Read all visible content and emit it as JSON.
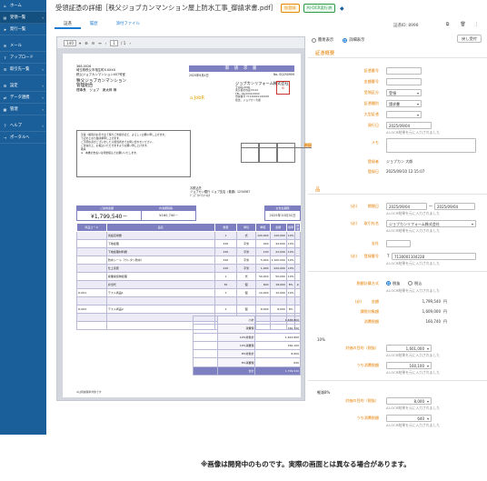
{
  "sidebar": {
    "items": [
      {
        "label": "ホーム",
        "icon": "home-icon",
        "active": false
      },
      {
        "label": "受領一覧",
        "icon": "inbox-icon",
        "active": true
      },
      {
        "label": "発行一覧",
        "icon": "send-icon",
        "active": false
      },
      {
        "label": "メール",
        "icon": "mail-icon",
        "active": false
      },
      {
        "label": "アップロード",
        "icon": "upload-icon",
        "active": false
      },
      {
        "label": "取引先一覧",
        "icon": "address-book-icon",
        "active": false
      },
      {
        "label": "設定",
        "icon": "gear-icon",
        "active": false
      },
      {
        "label": "データ連携",
        "icon": "link-icon",
        "active": false
      },
      {
        "label": "管理",
        "icon": "admin-icon",
        "active": false
      },
      {
        "label": "ヘルプ",
        "icon": "help-icon",
        "active": false
      },
      {
        "label": "ポータルへ",
        "icon": "arrow-right-icon",
        "active": false
      }
    ]
  },
  "header": {
    "title": "受領証憑の詳細［秩父ジョブカンマンション屋上防水工事_御請求書.pdf］",
    "badge_status": "仮登録",
    "badge_ai": "AI-OCR実行済",
    "doc_id": "証憑ID: 8998",
    "back_label": "戻し受付"
  },
  "tabs": [
    {
      "label": "証憑",
      "active": true
    },
    {
      "label": "履歴",
      "active": false
    },
    {
      "label": "添付ファイル",
      "active": false
    }
  ],
  "viewer": {
    "zoom": "140",
    "page_current": "1",
    "page_total": "/ 1"
  },
  "invoice": {
    "sender_lines": [
      "368-0026",
      "埼玉県秩父市相生町X-XXXX",
      "秩父ジョブカンマンション407号室"
    ],
    "recipient_name": "秩父ジョブカンマンション",
    "recipient_dept": "管理組合",
    "recipient_person": "理事長　ジョブ　席太郎 様",
    "title": "御 請 求 書",
    "date": "2025年9月4日",
    "number": "No. SQ250909",
    "company": "ジョブカンリフォーム株式会社",
    "address_lines": [
      "〒000-0000",
      "東京都渋谷区XX-XX",
      "TEL: 00-0000-0000",
      "登録番号 T7130001104228",
      "担当：ジョブカン大郎"
    ],
    "logo_text": "JobR",
    "seal_text": "印",
    "note_lines": [
      "平素（格別のお引き立て賜りご支援のほど、よろしくお願い申し上げます。",
      "下記のとおり御請求申し上げます。",
      "ご不明な点がございましたら担当者までお問い合わせください。",
      "ご査収の上、お振込いただきますようお願い申し上げます。",
      "",
      "敬具",
      "※　本書の支払いは現金振込でお願いいたします。"
    ],
    "stamp_labels": [
      "検印",
      "承認",
      "担当"
    ],
    "bank_lines": [
      "お振込先",
      "ジョブカン銀行 ジョブ支店（普通）1234567",
      "ｼﾞｮﾌﾞｶﾝﾘﾌｫｰﾑ(ｶ"
    ],
    "total_head": [
      "ご請求金額",
      "内消費税等"
    ],
    "total_amount": "¥1,799,540－",
    "tax_amount": "¥160,740－",
    "due_label": "お支払期限",
    "due_date": "2025年10月31日",
    "table_headers": [
      "商品コード",
      "品名",
      "数量",
      "単位",
      "単価",
      "金額",
      "税率",
      "摘要"
    ],
    "rows": [
      [
        "",
        "仮設足場費",
        "1",
        "式",
        "120,000",
        "120,000",
        "10%",
        ""
      ],
      [
        "",
        "下地処理",
        "220",
        "平米",
        "200",
        "44,000",
        "10%",
        ""
      ],
      [
        "",
        "下地処理材料費",
        "220",
        "平米",
        "100",
        "22,000",
        "10%",
        ""
      ],
      [
        "",
        "防水シート（ウレタン防水）",
        "220",
        "平米",
        "5,000",
        "1,100,000",
        "10%",
        ""
      ],
      [
        "",
        "仕上塗装",
        "220",
        "平米",
        "1,000",
        "220,000",
        "10%",
        ""
      ],
      [
        "",
        "産業廃棄物処理",
        "1",
        "式",
        "50,000",
        "50,000",
        "10%",
        ""
      ],
      [
        "",
        "弁当代",
        "30",
        "個",
        "600",
        "18,000",
        "8%",
        "※"
      ],
      [
        "D-001",
        "テスト商品1",
        "1",
        "個",
        "10,000",
        "10,000",
        "10%",
        ""
      ],
      [
        "",
        "",
        "",
        "",
        "",
        "",
        "",
        ""
      ],
      [
        "D-002",
        "テスト商品2",
        "1",
        "個",
        "8,000",
        "8,000",
        "8%",
        ""
      ],
      [
        "",
        "",
        "",
        "",
        "",
        "",
        "",
        ""
      ],
      [
        "",
        "",
        "",
        "",
        "",
        "",
        "",
        ""
      ]
    ],
    "summary": [
      [
        "小計",
        "1,638,800"
      ],
      [
        "消費税",
        "160,740"
      ],
      [
        "10%対象計",
        "1,612,800"
      ],
      [
        "10%消費税",
        "160,100"
      ],
      [
        "8%対象計",
        "8,000"
      ],
      [
        "8%消費税",
        "640"
      ],
      [
        "合計",
        "1,799,540"
      ]
    ],
    "footnote": "※は軽減税率対象です"
  },
  "panel": {
    "radio_simple": "簡易表示",
    "radio_detail": "詳細表示",
    "section_summary": "証憑概要",
    "fields_top": [
      {
        "label": "証憑番号",
        "value": "",
        "type": "input"
      },
      {
        "label": "金額番号",
        "value": "",
        "type": "input"
      },
      {
        "label": "受領区分",
        "value": "受領",
        "type": "select"
      },
      {
        "label": "証憑種別",
        "value": "請求書",
        "type": "select"
      },
      {
        "label": "大型証憑",
        "value": "",
        "type": "select"
      }
    ],
    "issue_date_label": "発行日",
    "issue_date": "2025/09/04",
    "ai_hint": "AI-OCR結果を元に入力されました",
    "memo_label": "メモ",
    "registrant_label": "登録者",
    "registrant": "ジョブカン 大郎",
    "registered_label": "登録日",
    "registered": "2025/09/10 12:15:07",
    "section_item": "品",
    "req_tag": "(必)",
    "period_label": "期間日",
    "period_from": "2025/09/04",
    "period_sep": "〜",
    "period_to": "2025/09/04",
    "partner_label": "取引先名",
    "partner": "ジョブカンリフォーム株式会社",
    "branch_label": "支社",
    "regno_label": "登録番号",
    "regno_prefix": "T",
    "regno": "7130001104228",
    "tax_calc_label": "税額計算方式",
    "tax_opt1": "税抜",
    "tax_opt2": "税込",
    "total_label": "金額",
    "total": "1,799,540",
    "yen": "円",
    "taxable_label": "課税対象額",
    "taxable": "1,609,000",
    "tax_label": "消費税額",
    "tax": "160,740",
    "rate10_title": "10%",
    "rate10_taxable_label": "対価の目的（税抜）",
    "rate10_taxable": "1,601,000",
    "rate10_tax_label": "うち消費税額",
    "rate10_tax": "160,100",
    "rate8_title": "軽減8%",
    "rate8_taxable_label": "対価の目的（税抜）",
    "rate8_taxable": "8,000",
    "rate8_tax_label": "うち消費税額",
    "rate8_tax": "640"
  },
  "notice": "※画像は開発中のものです。実際の画面とは異なる場合があります。"
}
